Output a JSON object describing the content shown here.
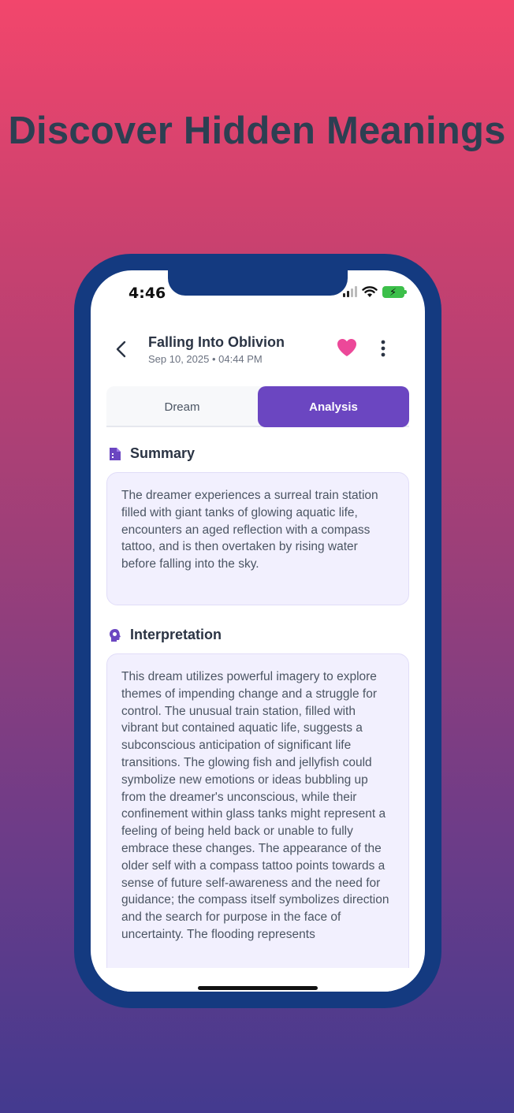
{
  "promo": {
    "headline": "Discover Hidden Meanings"
  },
  "status_bar": {
    "time": "4:46"
  },
  "header": {
    "title": "Falling Into Oblivion",
    "subtitle": "Sep 10, 2025 • 04:44 PM"
  },
  "tabs": [
    {
      "label": "Dream",
      "active": false
    },
    {
      "label": "Analysis",
      "active": true
    }
  ],
  "summary": {
    "heading": "Summary",
    "text": "The dreamer experiences a surreal train station filled with giant tanks of glowing aquatic life, encounters an aged reflection with a compass tattoo, and is then overtaken by rising water before falling into the sky."
  },
  "interpretation": {
    "heading": "Interpretation",
    "text": "This dream utilizes powerful imagery to explore themes of impending change and a struggle for control. The unusual train station, filled with vibrant but contained aquatic life, suggests a subconscious anticipation of significant life transitions. The glowing fish and jellyfish could symbolize new emotions or ideas bubbling up from the dreamer's unconscious, while their confinement within glass tanks might represent a feeling of being held back or unable to fully embrace these changes. The appearance of the older self with a compass tattoo points towards a sense of future self-awareness and the need for guidance; the compass itself symbolizes direction and the search for purpose in the face of uncertainty. The flooding represents"
  },
  "colors": {
    "accent": "#6b46c1",
    "heart": "#ec4899",
    "phone_frame": "#143a80",
    "card_bg": "#f2f0fe"
  }
}
